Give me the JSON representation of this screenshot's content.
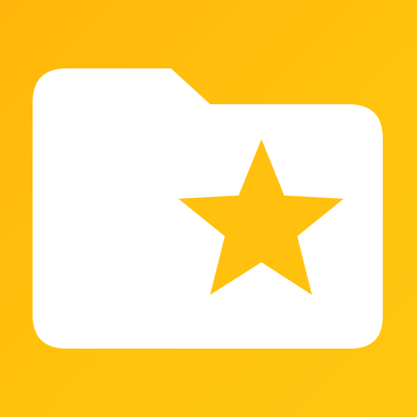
{
  "icon": {
    "name": "starred-folder",
    "glyph": "folder-icon",
    "badge": "star-icon"
  },
  "colors": {
    "background": "#FFC00E",
    "folder": "#FFFFFF",
    "star": "#FFC00E"
  }
}
